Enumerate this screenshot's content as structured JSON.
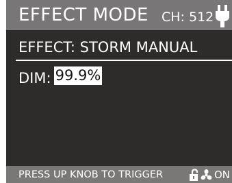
{
  "header": {
    "mode_title": "EFFECT MODE",
    "channel": "CH: 512",
    "power_icon": "plug-icon"
  },
  "effect": {
    "label": "EFFECT: STORM MANUAL"
  },
  "dim": {
    "label": "DIM:",
    "value": "99.9%"
  },
  "footer": {
    "instruction": "PRESS UP KNOB TO TRIGGER",
    "lock_icon": "lock-icon",
    "fan_icon": "fan-icon",
    "fan_state": "ON"
  },
  "colors": {
    "screen_bg": "#2e2c2b",
    "header_bg": "#787676",
    "footer_bg": "#7a7877",
    "text": "#ffffff",
    "highlight_bg": "#ffffff",
    "highlight_text": "#141414"
  }
}
